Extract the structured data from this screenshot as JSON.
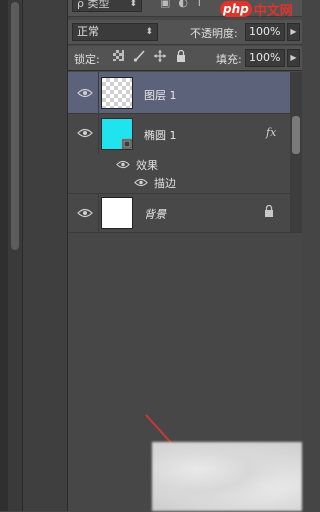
{
  "filter": {
    "kind_select": "ρ 类型",
    "watermark_logo_text": "php",
    "watermark_site_text": "中文网"
  },
  "blend": {
    "mode": "正常",
    "opacity_label": "不透明度:",
    "opacity_value": "100%"
  },
  "lock": {
    "label": "锁定:",
    "icons": [
      "transparency-lock-icon",
      "brush-lock-icon",
      "move-lock-icon",
      "all-lock-icon"
    ],
    "fill_label": "填充:",
    "fill_value": "100%"
  },
  "layers": [
    {
      "name": "图层 1",
      "selected": true,
      "thumb": "transparent"
    },
    {
      "name": "椭圆 1",
      "selected": false,
      "thumb": "cyan-shape",
      "fx": "fx",
      "effects_label": "效果",
      "effect_items": [
        "描边"
      ]
    },
    {
      "name": "背景",
      "selected": false,
      "thumb": "white",
      "locked": true
    }
  ],
  "colors": {
    "panel_bg": "#484848",
    "selected_row": "#5c627a",
    "shape_color": "#1fe3ee",
    "arrow_color": "#c83a33"
  }
}
